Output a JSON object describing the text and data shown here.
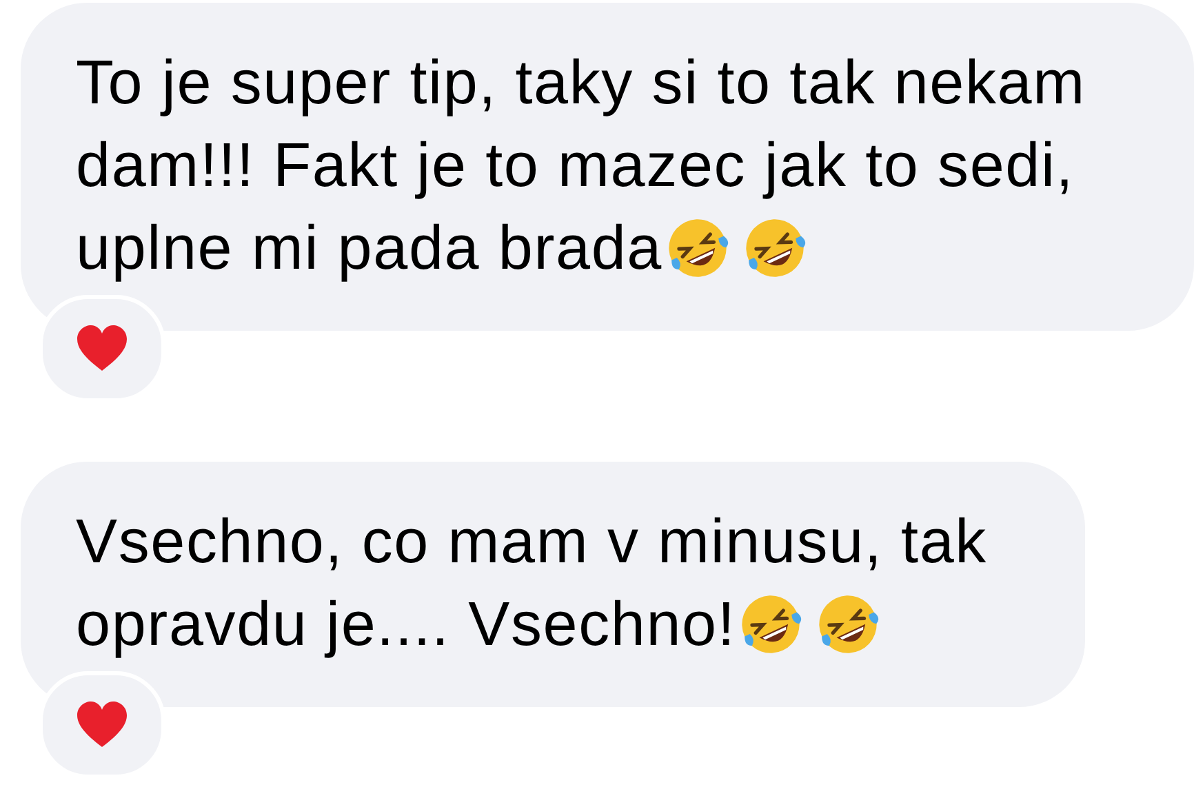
{
  "messages": [
    {
      "text": "To je super tip, taky si to tak nekam\ndam!!! Fakt je to mazec jak to sedi,\nuplne mi pada brada",
      "emojis": [
        {
          "kind": "rofl"
        },
        {
          "kind": "rofl"
        }
      ],
      "reactions": [
        {
          "kind": "heart"
        }
      ]
    },
    {
      "text": "Vsechno, co mam v minusu, tak\nopravdu je.... Vsechno!",
      "emojis": [
        {
          "kind": "rofl"
        },
        {
          "kind": "rofl"
        }
      ],
      "reactions": [
        {
          "kind": "heart"
        }
      ]
    }
  ]
}
